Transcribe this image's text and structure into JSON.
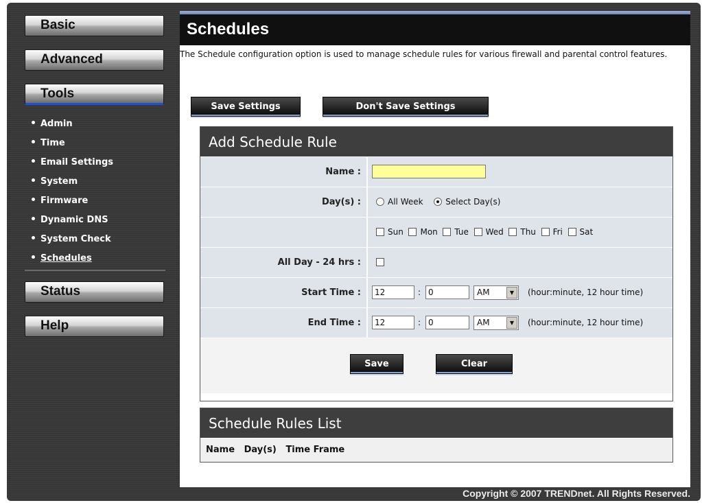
{
  "sidebar": {
    "nav": [
      "Basic",
      "Advanced",
      "Tools",
      "Status",
      "Help"
    ],
    "tools_items": [
      "Admin",
      "Time",
      "Email Settings",
      "System",
      "Firmware",
      "Dynamic DNS",
      "System Check",
      "Schedules"
    ]
  },
  "page": {
    "title": "Schedules",
    "description": "The Schedule configuration option is used to manage schedule rules for various firewall and parental control features.",
    "save_settings": "Save Settings",
    "dont_save_settings": "Don't Save Settings"
  },
  "add_rule": {
    "heading": "Add Schedule Rule",
    "name_label": "Name :",
    "name_value": "",
    "days_label": "Day(s) :",
    "all_week": "All Week",
    "select_days": "Select Day(s)",
    "days": [
      "Sun",
      "Mon",
      "Tue",
      "Wed",
      "Thu",
      "Fri",
      "Sat"
    ],
    "all_day_label": "All Day - 24 hrs :",
    "start_label": "Start Time :",
    "end_label": "End Time :",
    "start_hour": "12",
    "start_minute": "0",
    "start_ampm": "AM",
    "end_hour": "12",
    "end_minute": "0",
    "end_ampm": "AM",
    "time_sep": ":",
    "time_hint": "(hour:minute, 12 hour time)",
    "save": "Save",
    "clear": "Clear"
  },
  "rules_list": {
    "heading": "Schedule Rules List",
    "columns": [
      "Name",
      "Day(s)",
      "Time Frame"
    ]
  },
  "footer": {
    "copyright": "Copyright © 2007 TRENDnet. All Rights Reserved."
  }
}
